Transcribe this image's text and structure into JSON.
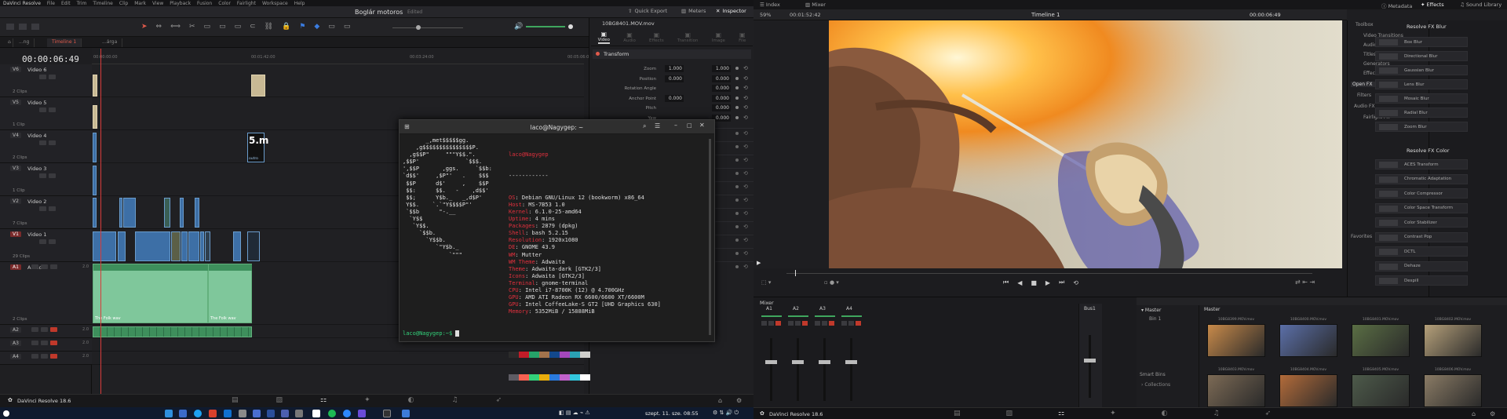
{
  "left_menu": [
    "DaVinci Resolve",
    "File",
    "Edit",
    "Trim",
    "Timeline",
    "Clip",
    "Mark",
    "View",
    "Playback",
    "Fusion",
    "Color",
    "Fairlight",
    "Workspace",
    "Help"
  ],
  "project": {
    "title": "Boglár motoros",
    "status": "Edited"
  },
  "top_buttons": {
    "quick_export": "Quick Export",
    "meters": "Meters",
    "inspector": "Inspector"
  },
  "timeline_tabs": [
    "...ng",
    "Timeline 1",
    "...árga"
  ],
  "timecode": "00:00:06:49",
  "ruler_labels": [
    "00:00:00:00",
    "00:01:42:00",
    "00:03:24:00",
    "00:05:06:00"
  ],
  "tracks": [
    {
      "id": "V6",
      "name": "Video 6",
      "clips": "2 Clips"
    },
    {
      "id": "V5",
      "name": "Video 5",
      "clips": "1 Clip"
    },
    {
      "id": "V4",
      "name": "Video 4",
      "clips": "2 Clips"
    },
    {
      "id": "V3",
      "name": "Video 3",
      "clips": "1 Clip"
    },
    {
      "id": "V2",
      "name": "Video 2",
      "clips": "7 Clips"
    },
    {
      "id": "V1",
      "name": "Video 1",
      "clips": "29 Clips"
    },
    {
      "id": "A1",
      "name": "Audio 1",
      "clips": "2 Clips",
      "level": "2.0"
    },
    {
      "id": "A2",
      "name": "",
      "clips": "",
      "level": "2.0"
    },
    {
      "id": "A3",
      "name": "",
      "clips": "",
      "level": "2.0"
    },
    {
      "id": "A4",
      "name": "",
      "clips": "",
      "level": "2.0"
    }
  ],
  "audio_clip_labels": [
    "The Folk wav",
    "The Folk wav"
  ],
  "title_clip_label": "outro",
  "inspector": {
    "filename": "10BG8401.MOV.mov",
    "tabs": [
      "Video",
      "Audio",
      "Effects",
      "Transition",
      "Image",
      "File"
    ],
    "section": "Transform",
    "rows": [
      {
        "label": "Zoom",
        "x": "1.000",
        "y": "1.000"
      },
      {
        "label": "Position",
        "x": "0.000",
        "y": "0.000"
      },
      {
        "label": "Rotation Angle",
        "x": "",
        "y": "0.000"
      },
      {
        "label": "Anchor Point",
        "x": "0.000",
        "y": "0.000"
      },
      {
        "label": "Pitch",
        "x": "",
        "y": "0.000"
      },
      {
        "label": "Yaw",
        "x": "",
        "y": "0.000"
      }
    ]
  },
  "terminal": {
    "title": "laco@Nagygep: ~",
    "ascii": [
      "       _,met$$$$$gg.",
      "    ,g$$$$$$$$$$$$$$$P.",
      "  ,g$$P\"     \"\"\"Y$$.\".",
      ",$$P'              `$$$.",
      "',$$P       ,ggs.     `$$b:",
      "`d$$'     ,$P\"'   .    $$$",
      " $$P      d$'     ,    $$P",
      " $$:      $$.   -    ,d$$'",
      " $$;      Y$b._   _,d$P'",
      " Y$$.    `.`\"Y$$$$P\"'",
      " `$$b      \"-.__",
      "  `Y$$",
      "   `Y$$.",
      "     `$$b.",
      "       `Y$$b.",
      "          `\"Y$b._",
      "              `\"\"\""
    ],
    "user_host": "laco@Nagygep",
    "separator": "------------",
    "info": [
      {
        "k": "OS",
        "v": "Debian GNU/Linux 12 (bookworm) x86_64"
      },
      {
        "k": "Host",
        "v": "MS-7B53 1.0"
      },
      {
        "k": "Kernel",
        "v": "6.1.0-25-amd64"
      },
      {
        "k": "Uptime",
        "v": "4 mins"
      },
      {
        "k": "Packages",
        "v": "2879 (dpkg)"
      },
      {
        "k": "Shell",
        "v": "bash 5.2.15"
      },
      {
        "k": "Resolution",
        "v": "1920x1080"
      },
      {
        "k": "DE",
        "v": "GNOME 43.9"
      },
      {
        "k": "WM",
        "v": "Mutter"
      },
      {
        "k": "WM Theme",
        "v": "Adwaita"
      },
      {
        "k": "Theme",
        "v": "Adwaita-dark [GTK2/3]"
      },
      {
        "k": "Icons",
        "v": "Adwaita [GTK2/3]"
      },
      {
        "k": "Terminal",
        "v": "gnome-terminal"
      },
      {
        "k": "CPU",
        "v": "Intel i7-8700K (12) @ 4.700GHz"
      },
      {
        "k": "GPU",
        "v": "AMD ATI Radeon RX 6600/6600 XT/6600M"
      },
      {
        "k": "GPU",
        "v": "Intel CoffeeLake-S GT2 [UHD Graphics 630]"
      },
      {
        "k": "Memory",
        "v": "5352MiB / 15888MiB"
      }
    ],
    "swatches_top": [
      "#2b2b2b",
      "#c01c28",
      "#26a269",
      "#a2734c",
      "#12488b",
      "#a347ba",
      "#2aa1b3",
      "#d0cfcc"
    ],
    "swatches_bottom": [
      "#5e5c64",
      "#f66151",
      "#33d17a",
      "#e9ad0c",
      "#2a7bde",
      "#c061cb",
      "#33c7de",
      "#ffffff"
    ],
    "prompt": "laco@Nagygep:~$"
  },
  "left_statusbar": "DaVinci Resolve 18.6",
  "clock": "szept. 11. sze.  08:55",
  "right_top": {
    "index": "Index",
    "mixer": "Mixer",
    "metadata": "Metadata",
    "effects": "Effects",
    "sound_library": "Sound Library"
  },
  "viewer": {
    "zoom": "59%",
    "tc_left": "00:01:52:42",
    "timeline": "Timeline 1",
    "tc_right": "00:00:06:49"
  },
  "fx": {
    "tree": [
      "Toolbox",
      "Video Transitions",
      "Audio Transitions",
      "Titles",
      "Generators",
      "Effects",
      "Open FX",
      "Filters",
      "Audio FX",
      "Fairlight FX",
      "Favorites"
    ],
    "group1": "Resolve FX Blur",
    "blur_items": [
      "Box Blur",
      "Directional Blur",
      "Gaussian Blur",
      "Lens Blur",
      "Mosaic Blur",
      "Radial Blur",
      "Zoom Blur"
    ],
    "group2": "Resolve FX Color",
    "color_items": [
      "ACES Transform",
      "Chromatic Adaptation",
      "Color Compressor",
      "Color Space Transform",
      "Color Stabilizer",
      "Contrast Pop",
      "DCTL",
      "Dehaze",
      "Despill"
    ]
  },
  "mixer": {
    "title": "Mixer",
    "channels": [
      "A1",
      "A2",
      "A3",
      "A4"
    ],
    "bus": "Bus1"
  },
  "media": {
    "root": "Master",
    "bin": "Bin 1",
    "smart": "Smart Bins",
    "collections": "Collections",
    "header": "Master",
    "thumbs": [
      "10BG8399.MOV.mov",
      "10BG8400.MOV.mov",
      "10BG8401.MOV.mov",
      "10BG8402.MOV.mov",
      "10BG8403.MOV.mov",
      "10BG8404.MOV.mov",
      "10BG8405.MOV.mov",
      "10BG8406.MOV.mov"
    ]
  },
  "right_statusbar": "DaVinci Resolve 18.6"
}
